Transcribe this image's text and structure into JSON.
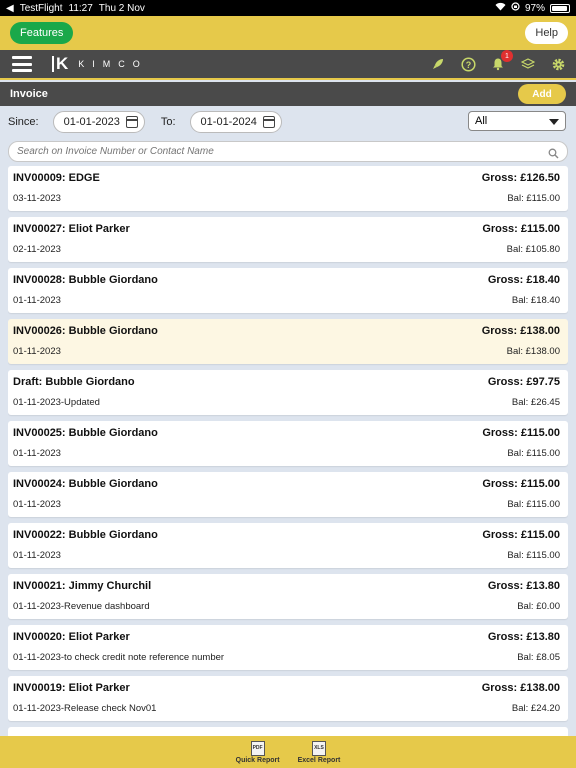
{
  "status": {
    "app": "TestFlight",
    "time": "11:27",
    "date": "Thu 2 Nov",
    "battery": "97%"
  },
  "topbar": {
    "features_label": "Features",
    "help_label": "Help"
  },
  "nav": {
    "logo_letter": "K",
    "logo_text": "KIMCO",
    "notification_count": "1",
    "icons": [
      "hamburger-icon",
      "rocket-icon",
      "help-circle-icon",
      "bell-icon",
      "layers-icon",
      "gear-icon"
    ]
  },
  "page": {
    "title": "Invoice",
    "add_label": "Add"
  },
  "filters": {
    "since_label": "Since:",
    "since_value": "01-01-2023",
    "to_label": "To:",
    "to_value": "01-01-2024",
    "status_value": "All"
  },
  "search": {
    "placeholder": "Search on Invoice Number or Contact Name"
  },
  "invoices": [
    {
      "title": "INV00009: EDGE",
      "date": "03-11-2023",
      "gross": "Gross: £126.50",
      "bal": "Bal: £115.00"
    },
    {
      "title": "INV00027: Eliot Parker",
      "date": "02-11-2023",
      "gross": "Gross: £115.00",
      "bal": "Bal: £105.80"
    },
    {
      "title": "INV00028: Bubble Giordano",
      "date": "01-11-2023",
      "gross": "Gross: £18.40",
      "bal": "Bal: £18.40"
    },
    {
      "title": "INV00026: Bubble Giordano",
      "date": "01-11-2023",
      "gross": "Gross: £138.00",
      "bal": "Bal: £138.00"
    },
    {
      "title": "Draft: Bubble Giordano",
      "date": "01-11-2023-Updated",
      "gross": "Gross: £97.75",
      "bal": "Bal: £26.45"
    },
    {
      "title": "INV00025: Bubble Giordano",
      "date": "01-11-2023",
      "gross": "Gross: £115.00",
      "bal": "Bal: £115.00"
    },
    {
      "title": "INV00024: Bubble Giordano",
      "date": "01-11-2023",
      "gross": "Gross: £115.00",
      "bal": "Bal: £115.00"
    },
    {
      "title": "INV00022: Bubble Giordano",
      "date": "01-11-2023",
      "gross": "Gross: £115.00",
      "bal": "Bal: £115.00"
    },
    {
      "title": "INV00021: Jimmy Churchil",
      "date": "01-11-2023-Revenue dashboard",
      "gross": "Gross: £13.80",
      "bal": "Bal: £0.00"
    },
    {
      "title": "INV00020: Eliot Parker",
      "date": "01-11-2023-to check credit note reference number",
      "gross": "Gross: £13.80",
      "bal": "Bal: £8.05"
    },
    {
      "title": "INV00019: Eliot Parker",
      "date": "01-11-2023-Release check Nov01",
      "gross": "Gross: £138.00",
      "bal": "Bal: £24.20"
    }
  ],
  "footer": {
    "pdf_icon_text": "PDF",
    "pdf_label": "Quick Report",
    "xls_icon_text": "XLS",
    "xls_label": "Excel Report"
  },
  "colors": {
    "accent_yellow": "#e6c94a",
    "nav_dark": "#4a4a4a",
    "features_green": "#1aa84a",
    "highlight_row": "#fdf7e3"
  }
}
